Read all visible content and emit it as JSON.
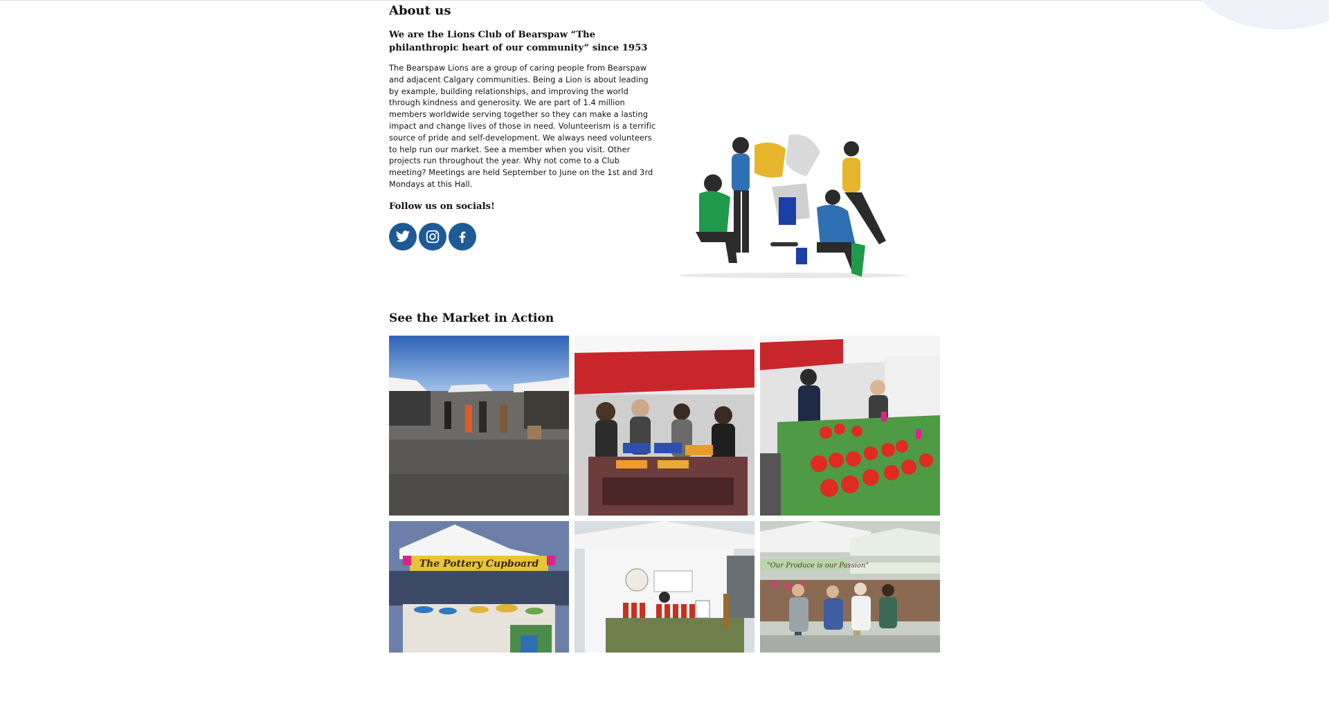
{
  "about": {
    "heading": "About us",
    "tagline": "We are the Lions Club of Bearspaw “The philanthropic heart of our community” since 1953",
    "intro": "The Bearspaw Lions are a group of caring people from Bearspaw and adjacent Calgary communities. Being a Lion is about leading by example, building relationships, and improving the world through kindness and generosity. We are part of 1.4 million members worldwide serving together so they can make a lasting impact and change lives of those in need. Volunteerism is a terrific source of pride and self-development. We always need volunteers to help run our market. See a member when you visit. Other projects run throughout the year. Why not come to a Club meeting? Meetings are held September to June on the 1st and 3rd Mondays at this Hall.",
    "follow_heading": "Follow us on socials!",
    "socials": [
      {
        "icon": "twitter-icon"
      },
      {
        "icon": "instagram-icon"
      },
      {
        "icon": "facebook-icon"
      }
    ],
    "illustration_icon": "team-puzzle-illustration"
  },
  "gallery": {
    "heading": "See the Market in Action",
    "photos": [
      {
        "subject": "market-aisle"
      },
      {
        "subject": "berry-stall"
      },
      {
        "subject": "tomato-stall"
      },
      {
        "subject": "pottery-stall",
        "sign_text": "The Pottery Cupboard"
      },
      {
        "subject": "sauce-stall"
      },
      {
        "subject": "produce-stall",
        "sign_text": "\"Our Produce is our Passion\""
      }
    ]
  },
  "colors": {
    "social_blue": "#1d5a96",
    "text": "#111111",
    "corner_blob": "#eef2f8"
  }
}
